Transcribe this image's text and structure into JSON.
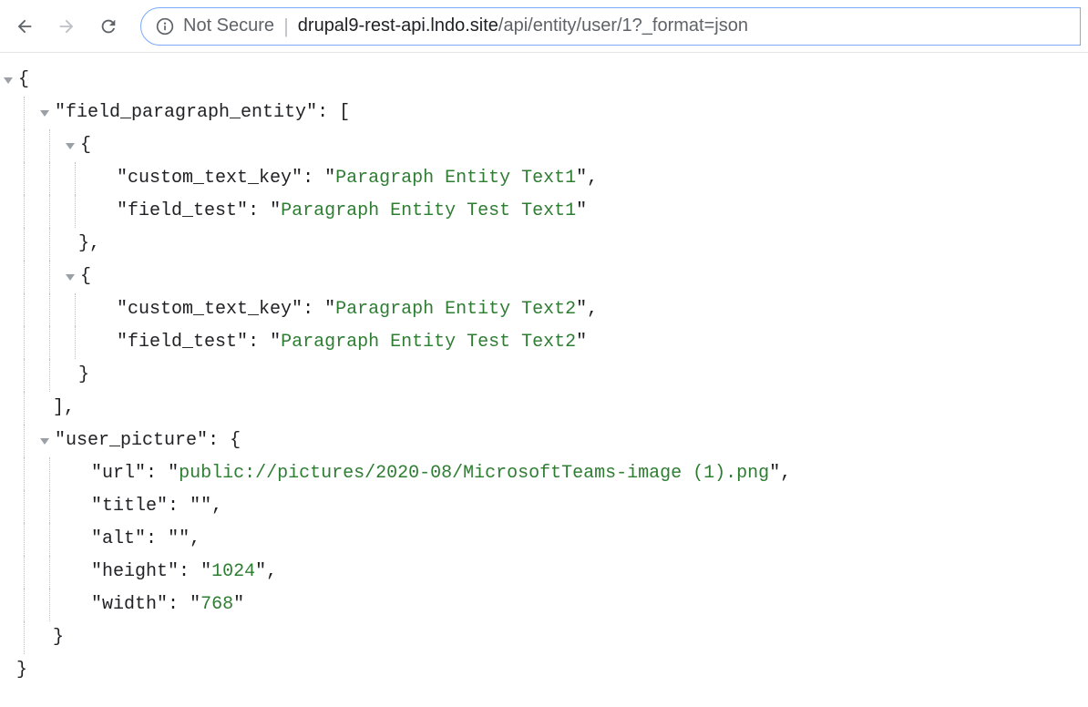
{
  "toolbar": {
    "security_label": "Not Secure",
    "url_host": "drupal9-rest-api.lndo.site",
    "url_path": "/api/entity/user/1?_format=json"
  },
  "json": {
    "open_brace": "{",
    "close_brace": "}",
    "open_bracket": "[",
    "close_bracket": "]",
    "comma": ",",
    "colon": ": ",
    "q": "\"",
    "keys": {
      "field_paragraph_entity": "field_paragraph_entity",
      "custom_text_key": "custom_text_key",
      "field_test": "field_test",
      "user_picture": "user_picture",
      "url": "url",
      "title": "title",
      "alt": "alt",
      "height": "height",
      "width": "width"
    },
    "values": {
      "pe_text1": "Paragraph Entity Text1",
      "pe_test1": "Paragraph Entity Test Text1",
      "pe_text2": "Paragraph Entity Text2",
      "pe_test2": "Paragraph Entity Test Text2",
      "url": "public://pictures/2020-08/MicrosoftTeams-image (1).png",
      "title": "",
      "alt": "",
      "height": "1024",
      "width": "768"
    }
  }
}
